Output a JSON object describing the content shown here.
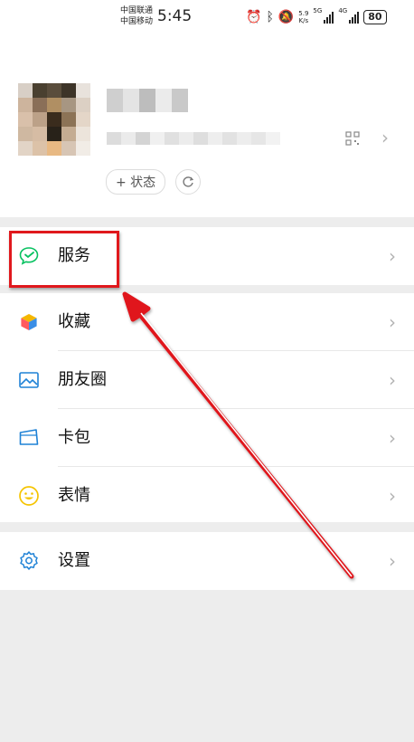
{
  "status_bar": {
    "carrier_1": "中国联通",
    "carrier_2": "中国移动",
    "time": "5:45",
    "net_speed_value": "5.9",
    "net_speed_unit": "K/s",
    "net_type_1": "5G",
    "net_type_2": "4G",
    "battery": "80"
  },
  "profile": {
    "status_label": "+ 状态",
    "add_icon": "plus-icon",
    "refresh_icon": "refresh-icon",
    "qr_icon": "qrcode-icon"
  },
  "menu": {
    "services": {
      "label": "服务",
      "icon": "wechat-pay-icon"
    },
    "favorites": {
      "label": "收藏",
      "icon": "cube-icon"
    },
    "moments": {
      "label": "朋友圈",
      "icon": "image-icon"
    },
    "cards": {
      "label": "卡包",
      "icon": "card-wallet-icon"
    },
    "stickers": {
      "label": "表情",
      "icon": "smile-icon"
    },
    "settings": {
      "label": "设置",
      "icon": "gear-icon"
    }
  },
  "colors": {
    "highlight": "#e0181d",
    "accent_green": "#07c160",
    "accent_blue": "#1f82d6",
    "background": "#ededed"
  }
}
